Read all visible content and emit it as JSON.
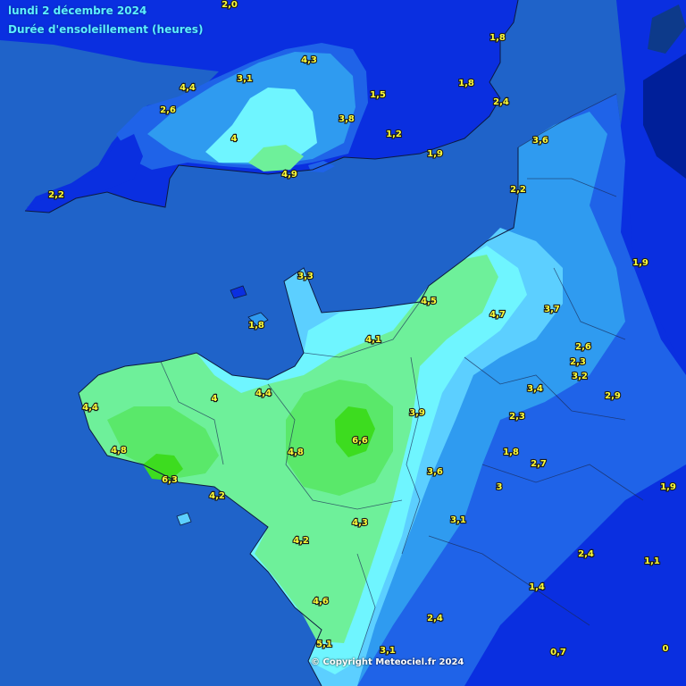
{
  "title": {
    "date": "lundi 2 décembre 2024",
    "variable": "Durée d'ensoleillement (heures)"
  },
  "copyright": "© Copyright Meteociel.fr 2024",
  "colors": {
    "sea": "#1f63c9",
    "band_lt_1": "#001f99",
    "band_1_2": "#0a2fe0",
    "band_2_3": "#1f63e8",
    "band_3_3_5": "#2f9bf0",
    "band_3_5_4": "#5ccfff",
    "band_4_4_5": "#6ff5ff",
    "band_4_5_5": "#6ef09a",
    "band_5_6": "#5ae86a",
    "band_gt_6": "#3ddc1f",
    "value_text": "#ffff3a"
  },
  "values": [
    {
      "label": "2,0"
    },
    {
      "label": "1,8"
    },
    {
      "label": "4,3"
    },
    {
      "label": "4,4"
    },
    {
      "label": "3,1"
    },
    {
      "label": "1,8"
    },
    {
      "label": "1,5"
    },
    {
      "label": "2,4"
    },
    {
      "label": "2,6"
    },
    {
      "label": "3,8"
    },
    {
      "label": "1,2"
    },
    {
      "label": "3,6"
    },
    {
      "label": "4"
    },
    {
      "label": "1,9"
    },
    {
      "label": "4,9"
    },
    {
      "label": "2,2"
    },
    {
      "label": "2,2"
    },
    {
      "label": "1,9"
    },
    {
      "label": "3,3"
    },
    {
      "label": "4,5"
    },
    {
      "label": "4,7"
    },
    {
      "label": "3,7"
    },
    {
      "label": "1,8"
    },
    {
      "label": "4,1"
    },
    {
      "label": "2,6"
    },
    {
      "label": "2,3"
    },
    {
      "label": "3,2"
    },
    {
      "label": "3,4"
    },
    {
      "label": "2,9"
    },
    {
      "label": "4,4"
    },
    {
      "label": "4"
    },
    {
      "label": "4,4"
    },
    {
      "label": "3,9"
    },
    {
      "label": "2,3"
    },
    {
      "label": "6,6"
    },
    {
      "label": "4,8"
    },
    {
      "label": "4,8"
    },
    {
      "label": "1,8"
    },
    {
      "label": "2,7"
    },
    {
      "label": "6,3"
    },
    {
      "label": "3,6"
    },
    {
      "label": "3"
    },
    {
      "label": "1,9"
    },
    {
      "label": "4,2"
    },
    {
      "label": "3,1"
    },
    {
      "label": "4,3"
    },
    {
      "label": "4,2"
    },
    {
      "label": "2,4"
    },
    {
      "label": "1,1"
    },
    {
      "label": "1,4"
    },
    {
      "label": "4,6"
    },
    {
      "label": "2,4"
    },
    {
      "label": "5,1"
    },
    {
      "label": "3,1"
    },
    {
      "label": "0,7"
    },
    {
      "label": "0"
    }
  ]
}
